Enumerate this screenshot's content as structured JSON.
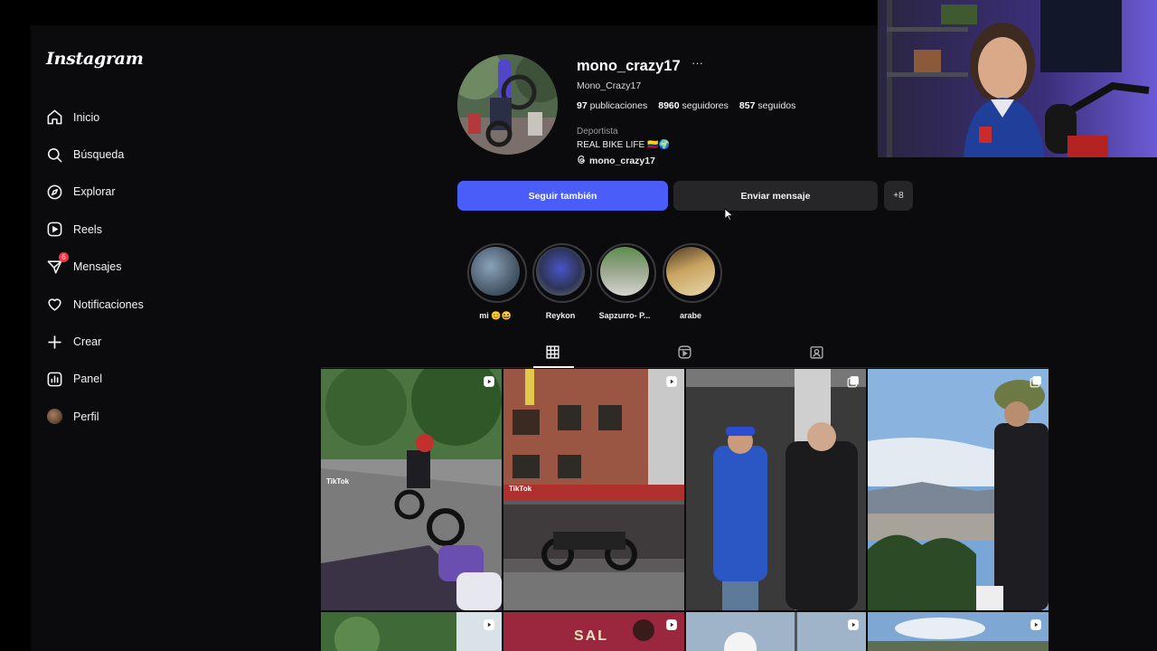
{
  "app": {
    "logo": "Instagram"
  },
  "sidebar": {
    "items": [
      {
        "label": "Inicio",
        "icon": "home-icon"
      },
      {
        "label": "Búsqueda",
        "icon": "search-icon"
      },
      {
        "label": "Explorar",
        "icon": "compass-icon"
      },
      {
        "label": "Reels",
        "icon": "reels-icon"
      },
      {
        "label": "Mensajes",
        "icon": "messenger-icon",
        "badge": "6"
      },
      {
        "label": "Notificaciones",
        "icon": "heart-icon"
      },
      {
        "label": "Crear",
        "icon": "plus-icon"
      },
      {
        "label": "Panel",
        "icon": "dashboard-icon"
      },
      {
        "label": "Perfil",
        "icon": "avatar-icon"
      }
    ]
  },
  "profile": {
    "username": "mono_crazy17",
    "more": "···",
    "full_name": "Mono_Crazy17",
    "posts_count": "97",
    "posts_label": "publicaciones",
    "followers_count": "8960",
    "followers_label": "seguidores",
    "following_count": "857",
    "following_label": "seguidos",
    "category": "Deportista",
    "bio": "REAL BIKE LIFE 🇨🇴🌍",
    "threads_handle": "mono_crazy17"
  },
  "actions": {
    "follow_label": "Seguir también",
    "message_label": "Enviar mensaje",
    "add_label": "+8"
  },
  "highlights": [
    {
      "label": "mi 😊😆"
    },
    {
      "label": "Reykon"
    },
    {
      "label": "Sapzurro- P..."
    },
    {
      "label": "arabe"
    }
  ],
  "tabs": [
    {
      "name": "posts",
      "icon": "grid-icon"
    },
    {
      "name": "reels",
      "icon": "reels-icon"
    },
    {
      "name": "tagged",
      "icon": "tagged-icon"
    }
  ],
  "posts": [
    {
      "overlay": "TikTok",
      "type": "reel"
    },
    {
      "overlay": "TikTok",
      "type": "reel"
    },
    {
      "overlay": "",
      "type": "carousel"
    },
    {
      "overlay": "",
      "type": "carousel"
    },
    {
      "overlay": "",
      "type": "reel"
    },
    {
      "overlay": "SAL",
      "type": "reel"
    },
    {
      "overlay": "",
      "type": "reel"
    },
    {
      "overlay": "",
      "type": "reel"
    }
  ],
  "colors": {
    "accent": "#4a5df9",
    "badge": "#ff3040",
    "background": "#0b0b0d"
  }
}
